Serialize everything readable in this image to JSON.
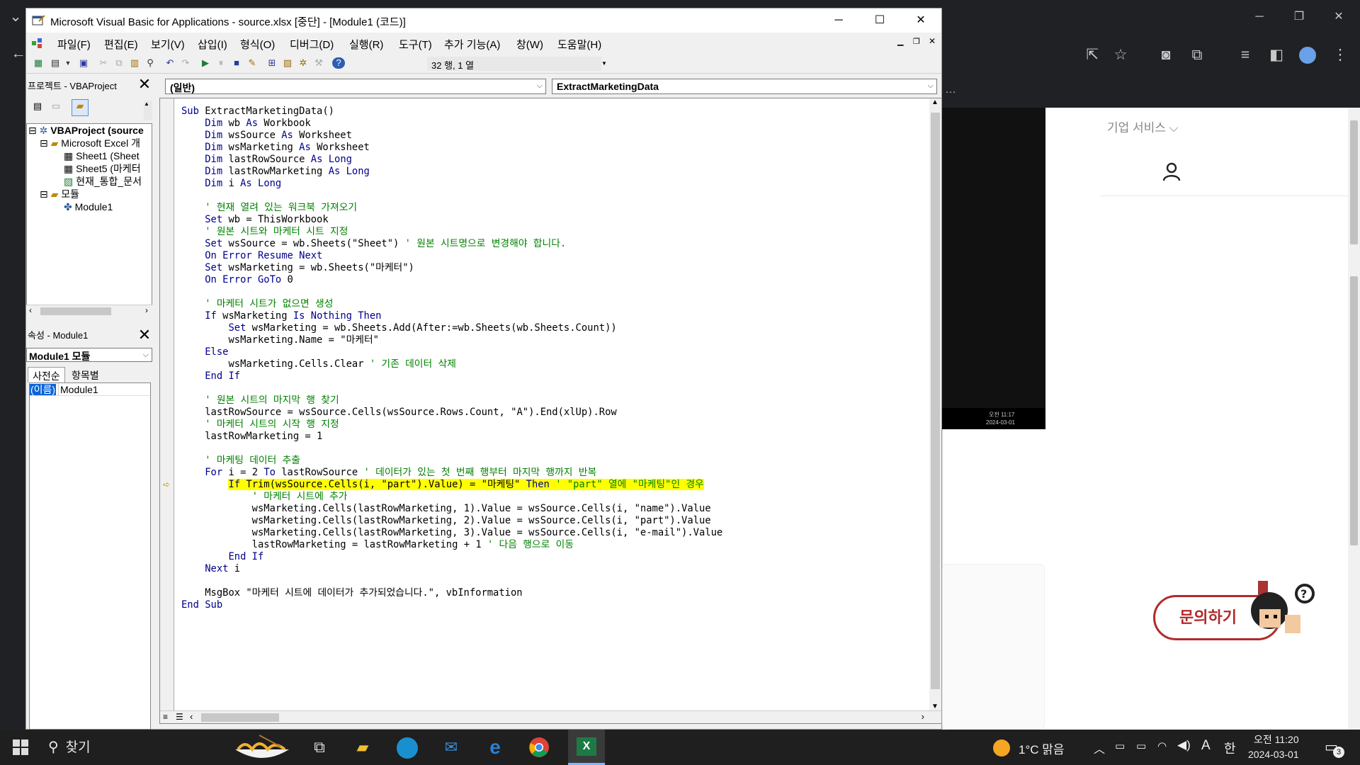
{
  "window": {
    "title": "Microsoft Visual Basic for Applications - source.xlsx [중단] - [Module1 (코드)]",
    "minimize": "─",
    "maximize": "☐",
    "close": "✕"
  },
  "menu": [
    "파일(F)",
    "편집(E)",
    "보기(V)",
    "삽입(I)",
    "형식(O)",
    "디버그(D)",
    "실행(R)",
    "도구(T)",
    "추가 기능(A)",
    "창(W)",
    "도움말(H)"
  ],
  "toolbar": {
    "position": "32 행, 1 열"
  },
  "project": {
    "title": "프로젝트 - VBAProject",
    "close": "✕",
    "tree": [
      {
        "label": "VBAProject (source",
        "level": 0
      },
      {
        "label": "Microsoft Excel 개",
        "level": 1
      },
      {
        "label": "Sheet1 (Sheet",
        "level": 2
      },
      {
        "label": "Sheet5 (마케터",
        "level": 2
      },
      {
        "label": "현재_통합_문서",
        "level": 2
      },
      {
        "label": "모듈",
        "level": 1
      },
      {
        "label": "Module1",
        "level": 2
      }
    ]
  },
  "properties": {
    "title": "속성 - Module1",
    "close": "✕",
    "object": "Module1 모듈",
    "tab_alpha": "사전순",
    "tab_category": "항목별",
    "row_name": "(이름)",
    "row_value": "Module1"
  },
  "code_pane": {
    "object_combo": "(일반)",
    "proc_combo": "ExtractMarketingData"
  },
  "code_lines": [
    "Sub ExtractMarketingData()",
    "    Dim wb As Workbook",
    "    Dim wsSource As Worksheet",
    "    Dim wsMarketing As Worksheet",
    "    Dim lastRowSource As Long",
    "    Dim lastRowMarketing As Long",
    "    Dim i As Long",
    "",
    "    ' 현재 열려 있는 워크북 가져오기",
    "    Set wb = ThisWorkbook",
    "    ' 원본 시트와 마케터 시트 지정",
    "    Set wsSource = wb.Sheets(\"Sheet\") ' 원본 시트명으로 변경해야 합니다.",
    "    On Error Resume Next",
    "    Set wsMarketing = wb.Sheets(\"마케터\")",
    "    On Error GoTo 0",
    "",
    "    ' 마케터 시트가 없으면 생성",
    "    If wsMarketing Is Nothing Then",
    "        Set wsMarketing = wb.Sheets.Add(After:=wb.Sheets(wb.Sheets.Count))",
    "        wsMarketing.Name = \"마케터\"",
    "    Else",
    "        wsMarketing.Cells.Clear ' 기존 데이터 삭제",
    "    End If",
    "",
    "    ' 원본 시트의 마지막 행 찾기",
    "    lastRowSource = wsSource.Cells(wsSource.Rows.Count, \"A\").End(xlUp).Row",
    "    ' 마케터 시트의 시작 행 지정",
    "    lastRowMarketing = 1",
    "",
    "    ' 마케팅 데이터 추출",
    "    For i = 2 To lastRowSource ' 데이터가 있는 첫 번째 행부터 마지막 행까지 반복",
    "        If Trim(wsSource.Cells(i, \"part\").Value) = \"마케팅\" Then ' \"part\" 열에 \"마케팅\"인 경우",
    "            ' 마케터 시트에 추가",
    "            wsMarketing.Cells(lastRowMarketing, 1).Value = wsSource.Cells(i, \"name\").Value",
    "            wsMarketing.Cells(lastRowMarketing, 2).Value = wsSource.Cells(i, \"part\").Value",
    "            wsMarketing.Cells(lastRowMarketing, 3).Value = wsSource.Cells(i, \"e-mail\").Value",
    "            lastRowMarketing = lastRowMarketing + 1 ' 다음 행으로 이동",
    "        End If",
    "    Next i",
    "",
    "    MsgBox \"마케터 시트에 데이터가 추가되었습니다.\", vbInformation",
    "End Sub"
  ],
  "highlight_line": 31,
  "colors": {
    "keyword": "#00008b",
    "comment": "#008000",
    "highlight": "#ffff00"
  },
  "background_page": {
    "corp_menu": "기업 서비스 ⌵",
    "inquiry": "문의하기",
    "video_time": "오전 11:17",
    "video_date": "2024-03-01"
  },
  "taskbar": {
    "search": "찾기",
    "weather": "1°C  맑음",
    "ime": "한",
    "ime_a": "A",
    "time": "오전 11:20",
    "date": "2024-03-01",
    "notif_count": "3"
  }
}
